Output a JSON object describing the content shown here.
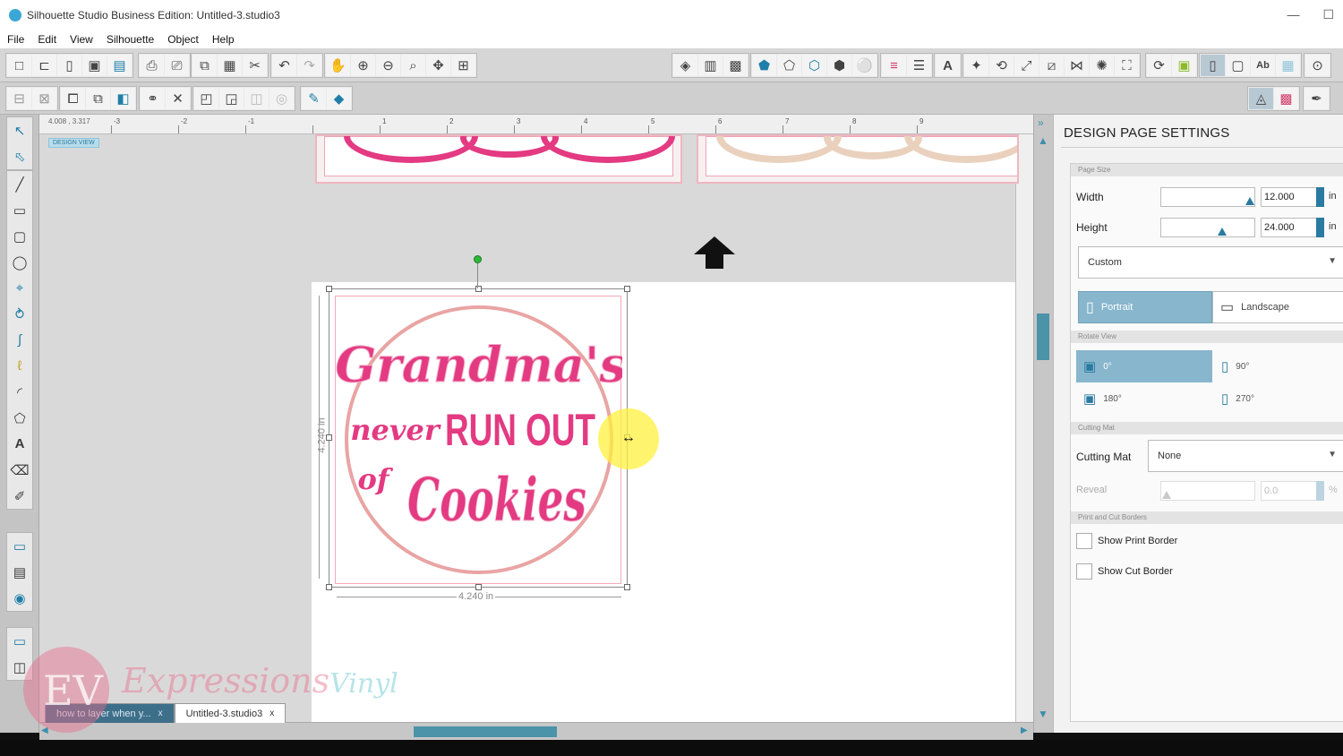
{
  "window": {
    "title": "Silhouette Studio Business Edition: Untitled-3.studio3",
    "minimize_glyph": "—",
    "maximize_glyph": "☐"
  },
  "menu": [
    "File",
    "Edit",
    "View",
    "Silhouette",
    "Object",
    "Help"
  ],
  "toolbar_icons": {
    "file_group": [
      "new-icon",
      "open-icon",
      "save-icon",
      "save-as-icon",
      "library-icon"
    ],
    "print_group": [
      "print-icon",
      "print-cut-icon"
    ],
    "clipboard_group": [
      "copy-icon",
      "paste-icon",
      "cut-icon"
    ],
    "history_group": [
      "undo-icon",
      "redo-icon"
    ],
    "view_group": [
      "pan-icon",
      "zoom-in-icon",
      "zoom-out-icon",
      "zoom-select-icon",
      "drag-icon",
      "fit-icon"
    ]
  },
  "canvas": {
    "ruler_coords": "4.008 , 3.317",
    "ruler_ticks": [
      "-3",
      "-2",
      "-1",
      "",
      "1",
      "2",
      "3",
      "4",
      "5",
      "6",
      "7",
      "8",
      "9"
    ],
    "design_view_tag": "DESIGN VIEW",
    "selection": {
      "width_label": "4.240 in",
      "height_label": "4.240 in"
    },
    "artwork": {
      "line1": "Grandma's",
      "line2a": "never",
      "line2b": "RUN OUT",
      "line3a": "of",
      "line3b": "Cookies",
      "primary_color": "#e33a82",
      "outline_color": "#e9a4a4"
    }
  },
  "tabs": [
    {
      "label": "how to layer when y...",
      "close": "x"
    },
    {
      "label": "Untitled-3.studio3",
      "close": "x"
    }
  ],
  "watermark": {
    "initials": "EV",
    "text": "Expressions",
    "text2": "Vinyl"
  },
  "panel": {
    "title": "DESIGN PAGE SETTINGS",
    "collapse_glyph": "»",
    "page_size": {
      "section": "Page Size",
      "width_label": "Width",
      "width_value": "12.000",
      "width_unit": "in",
      "width_fraction": 0.98,
      "height_label": "Height",
      "height_value": "24.000",
      "height_unit": "in",
      "height_fraction": 0.66,
      "size_preset": "Custom",
      "orientation": {
        "portrait": "Portrait",
        "landscape": "Landscape",
        "selected": "portrait"
      }
    },
    "rotate_view": {
      "section": "Rotate View",
      "options": [
        "0°",
        "90°",
        "180°",
        "270°"
      ],
      "selected": "0°"
    },
    "cutting_mat": {
      "section": "Cutting Mat",
      "label": "Cutting Mat",
      "value": "None",
      "reveal_label": "Reveal",
      "reveal_value": "0.0",
      "reveal_unit": "%"
    },
    "borders": {
      "section": "Print and Cut Borders",
      "show_print_border": "Show Print Border",
      "show_cut_border": "Show Cut Border"
    }
  },
  "colors": {
    "accent": "#2a7aa1",
    "selected_segment": "#87b6cd",
    "scroll_thumb": "#4a93a8"
  }
}
